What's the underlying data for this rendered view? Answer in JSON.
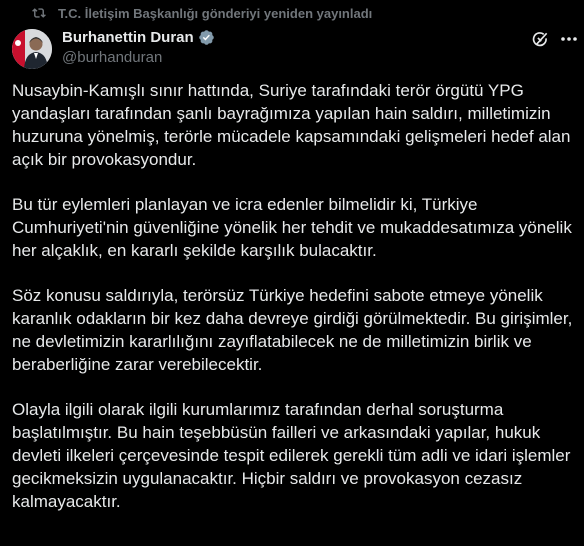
{
  "repost": {
    "text": "T.C. İletişim Başkanlığı gönderiyi yeniden yayınladı",
    "icon": "repost-icon"
  },
  "author": {
    "display_name": "Burhanettin Duran",
    "handle": "@burhanduran",
    "verified": true,
    "verified_color": "#829aab"
  },
  "actions": {
    "grok_icon": "grok-icon",
    "more_icon": "more-icon"
  },
  "colors": {
    "background": "#000000",
    "text": "#e7e9ea",
    "secondary": "#71767b"
  },
  "paragraphs": [
    "Nusaybin-Kamışlı sınır hattında, Suriye tarafındaki terör örgütü YPG yandaşları tarafından şanlı bayrağımıza yapılan hain saldırı, milletimizin huzuruna yönelmiş, terörle mücadele kapsamındaki gelişmeleri hedef alan açık bir provokasyondur.",
    "Bu tür eylemleri planlayan ve icra edenler bilmelidir ki, Türkiye Cumhuriyeti'nin güvenliğine yönelik her tehdit ve mukaddesatımıza yönelik her alçaklık, en kararlı şekilde karşılık bulacaktır.",
    "Söz konusu saldırıyla, terörsüz Türkiye hedefini sabote etmeye yönelik karanlık odakların bir kez daha devreye girdiği görülmektedir. Bu girişimler, ne devletimizin kararlılığını zayıflatabilecek ne de milletimizin birlik ve beraberliğine zarar verebilecektir.",
    "Olayla ilgili olarak ilgili kurumlarımız tarafından derhal soruşturma başlatılmıştır. Bu hain teşebbüsün failleri ve arkasındaki yapılar, hukuk devleti ilkeleri çerçevesinde tespit edilerek gerekli tüm adli ve idari işlemler gecikmeksizin uygulanacaktır. Hiçbir saldırı ve provokasyon cezasız kalmayacaktır."
  ]
}
